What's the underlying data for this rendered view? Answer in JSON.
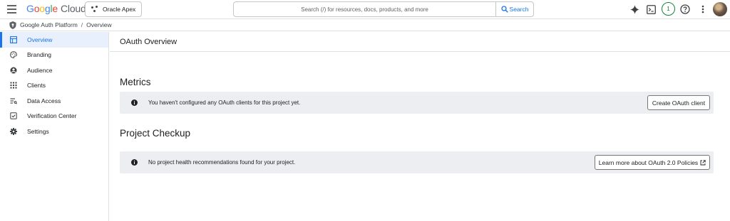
{
  "header": {
    "logo_google": [
      "G",
      "o",
      "o",
      "g",
      "l",
      "e"
    ],
    "logo_cloud": "Cloud",
    "project_name": "Oracle Apex",
    "search_placeholder": "Search (/) for resources, docs, products, and more",
    "search_button": "Search",
    "notification_count": "1",
    "icons": [
      "gemini-icon",
      "cloud-shell-icon",
      "help-icon",
      "more-vert-icon"
    ]
  },
  "breadcrumb": {
    "root": "Google Auth Platform",
    "separator": "/",
    "current": "Overview"
  },
  "sidebar": {
    "items": [
      {
        "label": "Overview",
        "icon": "dashboard-icon",
        "active": true
      },
      {
        "label": "Branding",
        "icon": "palette-icon"
      },
      {
        "label": "Audience",
        "icon": "account-circle-icon"
      },
      {
        "label": "Clients",
        "icon": "apps-grid-icon"
      },
      {
        "label": "Data Access",
        "icon": "data-access-icon"
      },
      {
        "label": "Verification Center",
        "icon": "verified-checkbox-icon"
      },
      {
        "label": "Settings",
        "icon": "gear-icon"
      }
    ]
  },
  "main": {
    "title": "OAuth Overview",
    "metrics": {
      "heading": "Metrics",
      "message": "You haven't configured any OAuth clients for this project yet.",
      "button": "Create OAuth client"
    },
    "checkup": {
      "heading": "Project Checkup",
      "message": "No project health recommendations found for your project.",
      "button": "Learn more about OAuth 2.0 Policies"
    }
  },
  "colors": {
    "accent": "#1a73e8",
    "banner_bg": "#eceef1",
    "active_nav_bg": "#e8f0fe",
    "notification": "#188038"
  }
}
